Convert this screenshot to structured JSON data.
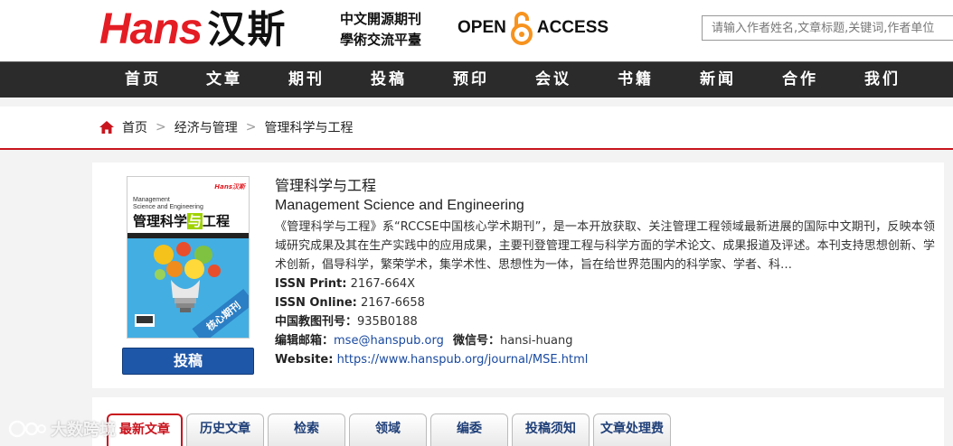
{
  "header": {
    "logo_text": "Hans",
    "logo_cn": "汉斯",
    "slogan_line1": "中文開源期刊",
    "slogan_line2": "學術交流平臺",
    "open_label": "OPEN",
    "access_label": "ACCESS",
    "search_placeholder": "请输入作者姓名,文章标题,关键词,作者单位"
  },
  "nav": {
    "items": [
      "首页",
      "文章",
      "期刊",
      "投稿",
      "预印",
      "会议",
      "书籍",
      "新闻",
      "合作",
      "我们"
    ]
  },
  "breadcrumb": {
    "items": [
      "首页",
      "经济与管理",
      "管理科学与工程"
    ],
    "separator": ">"
  },
  "journal": {
    "title_cn": "管理科学与工程",
    "title_en": "Management Science and Engineering",
    "description": "《管理科学与工程》系“RCCSE中国核心学术期刊”，是一本开放获取、关注管理工程领域最新进展的国际中文期刊，反映本领域研究成果及其在生产实践中的应用成果，主要刊登管理工程与科学方面的学术论文、成果报道及评述。本刊支持思想创新、学术创新，倡导科学，繁荣学术，集学术性、思想性为一体，旨在给世界范围内的科学家、学者、科…",
    "issn_print_label": "ISSN Print:",
    "issn_print": "2167-664X",
    "issn_online_label": "ISSN Online:",
    "issn_online": "2167-6658",
    "cn_code_label": "中国教图刊号：",
    "cn_code": "935B0188",
    "email_label": "编辑邮箱：",
    "email": "mse@hanspub.org",
    "wechat_label": "微信号：",
    "wechat": "hansi-huang",
    "website_label": "Website:",
    "website": "https://www.hanspub.org/journal/MSE.html",
    "submit_label": "投稿",
    "cover": {
      "hans": "Hans汉斯",
      "title_en_line1": "Management",
      "title_en_line2": "Science and Engineering",
      "title_cn_a": "管理科学",
      "title_cn_b": "与",
      "title_cn_c": "工程",
      "badge": "核心期刊"
    }
  },
  "tabs": {
    "items": [
      "最新文章",
      "历史文章",
      "检索",
      "领域",
      "编委",
      "投稿须知",
      "文章处理费"
    ],
    "active_index": 0
  },
  "watermark": {
    "text": "大数跨境"
  },
  "colors": {
    "brand_red": "#e41d24",
    "nav_bg": "#2b2b2b",
    "accent_red": "#c9151e",
    "button_blue": "#1f57a8",
    "link_blue": "#1a4aa0",
    "oa_orange": "#f7931e"
  },
  "icons": {
    "breadcrumb_home": "home-icon",
    "open_access": "open-lock-icon"
  }
}
